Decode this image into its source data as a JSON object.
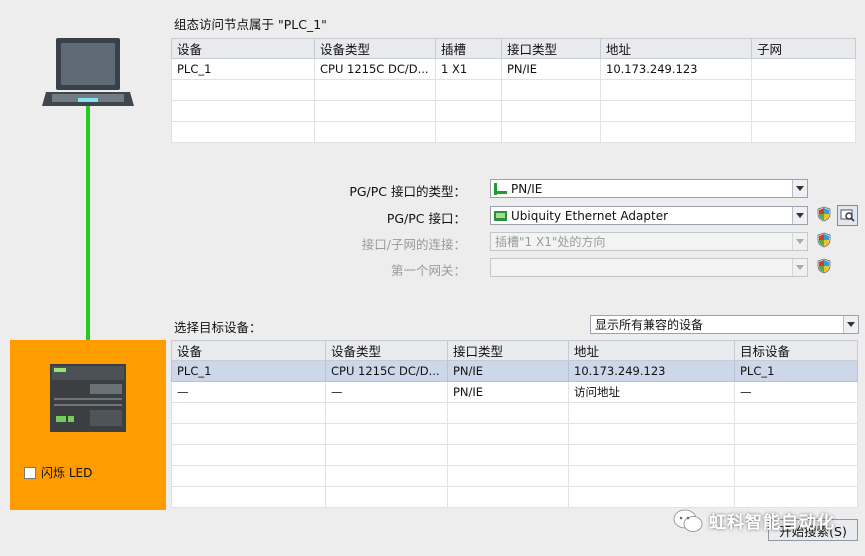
{
  "top_section": {
    "title": "组态访问节点属于 \"PLC_1\"",
    "columns": [
      "设备",
      "设备类型",
      "插槽",
      "接口类型",
      "地址",
      "子网"
    ],
    "rows": [
      [
        "PLC_1",
        "CPU 1215C DC/D...",
        "1 X1",
        "PN/IE",
        "10.173.249.123",
        ""
      ]
    ]
  },
  "interface_form": {
    "pgpc_type_label": "PG/PC 接口的类型：",
    "pgpc_type_value": "PN/IE",
    "pgpc_iface_label": "PG/PC 接口：",
    "pgpc_iface_value": "Ubiquity Ethernet Adapter",
    "subnet_conn_label": "接口/子网的连接：",
    "subnet_conn_value": "插槽\"1 X1\"处的方向",
    "gateway_label": "第一个网关：",
    "gateway_value": ""
  },
  "target_section": {
    "title": "选择目标设备：",
    "filter_value": "显示所有兼容的设备",
    "columns": [
      "设备",
      "设备类型",
      "接口类型",
      "地址",
      "目标设备"
    ],
    "rows": [
      [
        "PLC_1",
        "CPU 1215C DC/D...",
        "PN/IE",
        "10.173.249.123",
        "PLC_1"
      ],
      [
        "—",
        "—",
        "PN/IE",
        "访问地址",
        "—"
      ]
    ]
  },
  "left_panel": {
    "flash_led_label": "闪烁 LED",
    "line_color": "#22cc22",
    "target_bg_color": "#ff9d00"
  },
  "buttons": {
    "start_search": "开始搜索(S)"
  },
  "watermark": "虹科智能自动化"
}
